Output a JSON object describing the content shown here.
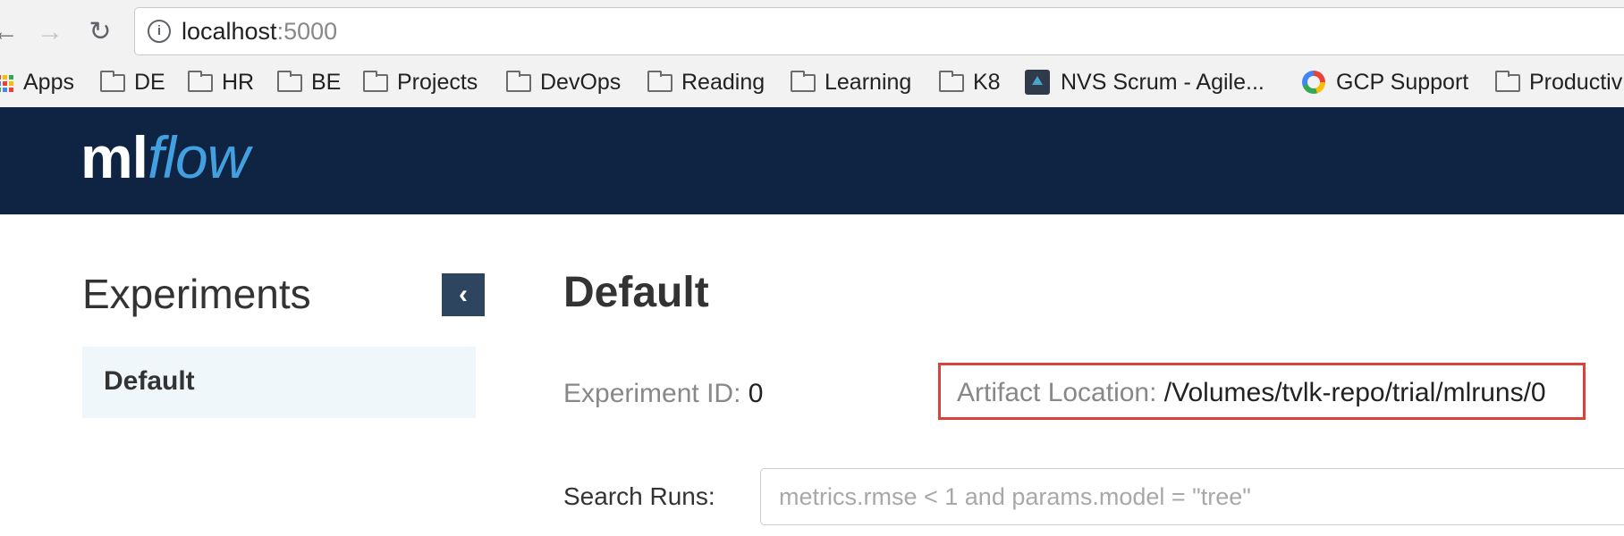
{
  "browser": {
    "url_host": "localhost",
    "url_port": ":5000",
    "bookmarks": [
      {
        "label": "Apps",
        "icon": "apps-grid-icon"
      },
      {
        "label": "DE",
        "icon": "folder-icon"
      },
      {
        "label": "HR",
        "icon": "folder-icon"
      },
      {
        "label": "BE",
        "icon": "folder-icon"
      },
      {
        "label": "Projects",
        "icon": "folder-icon"
      },
      {
        "label": "DevOps",
        "icon": "folder-icon"
      },
      {
        "label": "Reading",
        "icon": "folder-icon"
      },
      {
        "label": "Learning",
        "icon": "folder-icon"
      },
      {
        "label": "K8",
        "icon": "folder-icon"
      },
      {
        "label": "NVS Scrum - Agile...",
        "icon": "scrum-icon"
      },
      {
        "label": "GCP Support",
        "icon": "google-icon"
      },
      {
        "label": "Productiv",
        "icon": "folder-icon"
      }
    ]
  },
  "header": {
    "logo_ml": "ml",
    "logo_flow": "flow",
    "bg_color": "#0f2342",
    "accent_color": "#43a0e0"
  },
  "sidebar": {
    "title": "Experiments",
    "collapse_glyph": "‹",
    "items": [
      {
        "label": "Default",
        "selected": true
      }
    ]
  },
  "main": {
    "title": "Default",
    "experiment_id_label": "Experiment ID:",
    "experiment_id_value": "0",
    "artifact_label": "Artifact Location:",
    "artifact_value": "/Volumes/tvlk-repo/trial/mlruns/0",
    "highlight_color": "#d9443a",
    "search_label": "Search Runs:",
    "search_placeholder": "metrics.rmse < 1 and params.model = \"tree\"",
    "search_value": ""
  }
}
